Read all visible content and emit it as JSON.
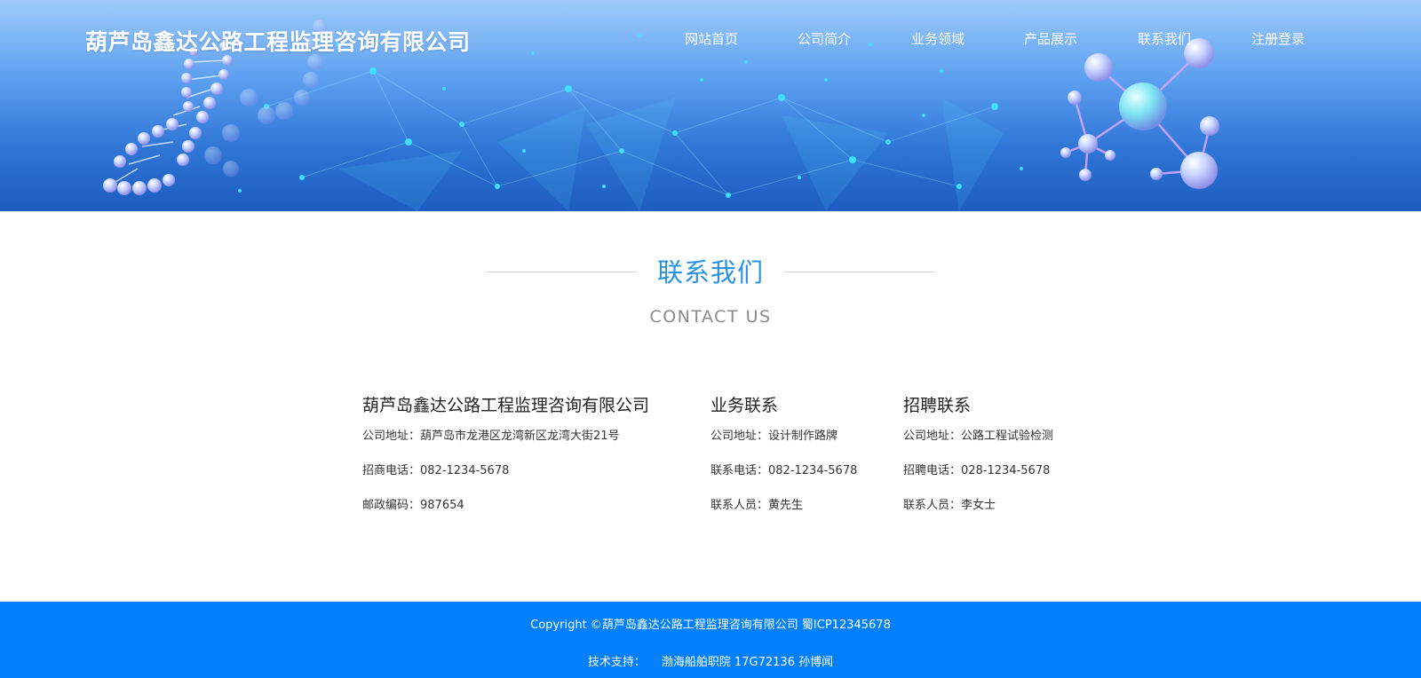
{
  "header": {
    "site_title": "葫芦岛鑫达公路工程监理咨询有限公司",
    "nav": [
      {
        "label": "网站首页"
      },
      {
        "label": "公司简介"
      },
      {
        "label": "业务领域"
      },
      {
        "label": "产品展示"
      },
      {
        "label": "联系我们"
      },
      {
        "label": "注册登录"
      }
    ]
  },
  "section": {
    "title_zh": "联系我们",
    "title_en": "CONTACT US"
  },
  "contacts": [
    {
      "title": "葫芦岛鑫达公路工程监理咨询有限公司",
      "rows": [
        "公司地址：葫芦岛市龙港区龙湾新区龙湾大街21号",
        "招商电话：082-1234-5678",
        "邮政编码：987654"
      ]
    },
    {
      "title": "业务联系",
      "rows": [
        "公司地址：设计制作路牌",
        "联系电话：082-1234-5678",
        "联系人员：黄先生"
      ]
    },
    {
      "title": "招聘联系",
      "rows": [
        "公司地址：公路工程试验检测",
        "招聘电话：028-1234-5678",
        "联系人员：李女士"
      ]
    }
  ],
  "footer": {
    "copyright": "Copyright ©葫芦岛鑫达公路工程监理咨询有限公司 蜀ICP12345678",
    "support_label": "技术支持：",
    "support_value": "渤海船舶职院 17G72136 孙博闻"
  },
  "colors": {
    "accent": "#2a93e0",
    "footer_bg": "#0080ff",
    "banner_dark": "#1d5cc0",
    "banner_light": "#9ecbfa"
  },
  "icons": [
    "dna-helix-decoration",
    "molecule-decoration",
    "network-particles-decoration"
  ]
}
